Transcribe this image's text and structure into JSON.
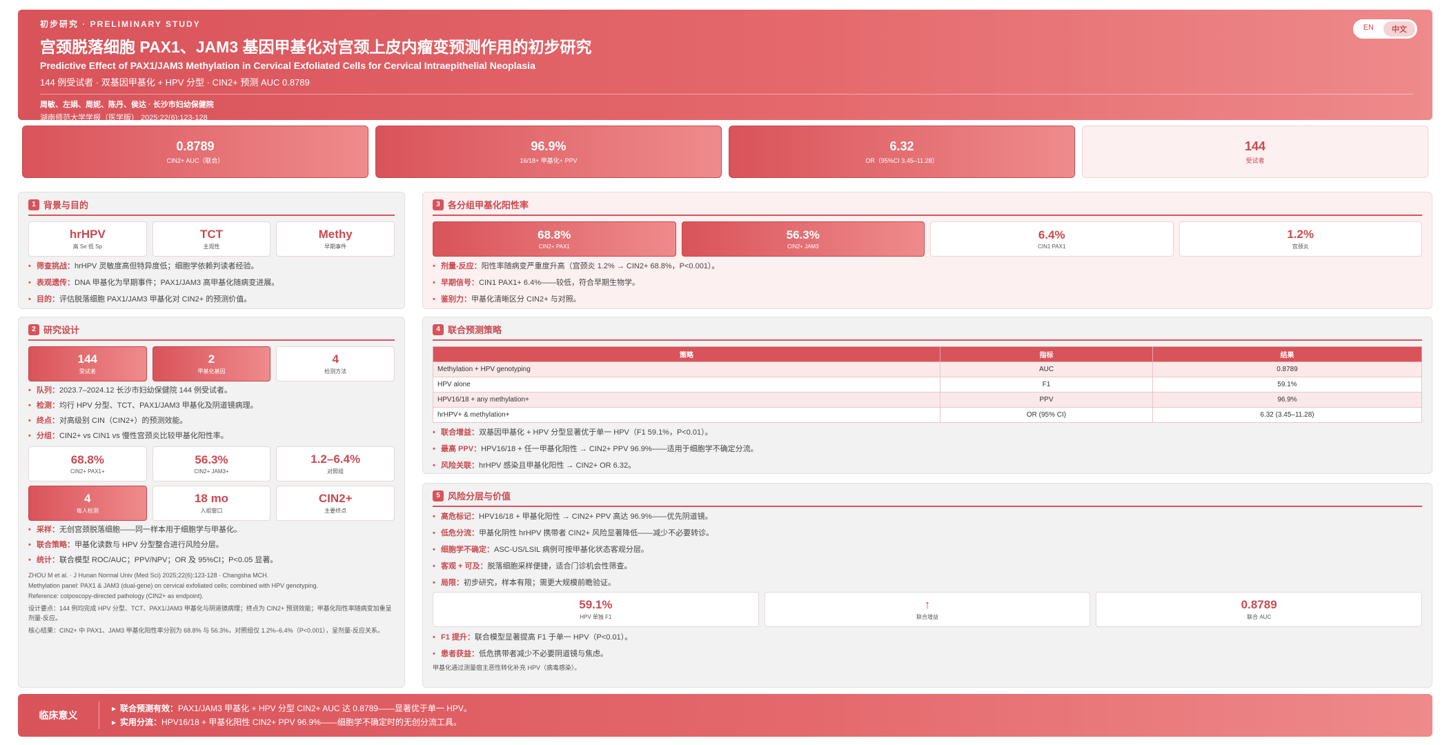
{
  "header": {
    "kicker": "初步研究 · PRELIMINARY STUDY",
    "title_zh": "宫颈脱落细胞 PAX1、JAM3 基因甲基化对宫颈上皮内瘤变预测作用的初步研究",
    "title_en": "Predictive Effect of PAX1/JAM3 Methylation in Cervical Exfoliated Cells for Cervical Intraepithelial Neoplasia",
    "summary": "144 例受试者 · 双基因甲基化 + HPV 分型 · CIN2+ 预测 AUC 0.8789",
    "authors": "周敏、左娟、周妮、陈丹、侯达 · 长沙市妇幼保健院",
    "journal": "湖南师范大学学报（医学版） 2025;22(6):123-128",
    "lang": [
      "EN",
      "中文"
    ]
  },
  "kpis": [
    {
      "value": "0.8789",
      "label": "CIN2+ AUC（联合）"
    },
    {
      "value": "96.9%",
      "label": "16/18+ 甲基化+ PPV"
    },
    {
      "value": "6.32",
      "label": "OR（95%CI 3.45–11.28）"
    },
    {
      "value": "144",
      "label": "受试者"
    }
  ],
  "s1": {
    "num": "1",
    "title": "背景与目的",
    "cards": [
      {
        "value": "hrHPV",
        "label": "高 Se 低 Sp"
      },
      {
        "value": "TCT",
        "label": "主观性"
      },
      {
        "value": "Methy",
        "label": "早期事件"
      }
    ],
    "bullets": [
      {
        "k": "筛查挑战：",
        "t": "hrHPV 灵敏度高但特异度低；细胞学依赖判读者经验。"
      },
      {
        "k": "表观遗传：",
        "t": "DNA 甲基化为早期事件；PAX1/JAM3 高甲基化随病变进展。"
      },
      {
        "k": "目的：",
        "t": "评估脱落细胞 PAX1/JAM3 甲基化对 CIN2+ 的预测价值。"
      }
    ]
  },
  "s2": {
    "num": "2",
    "title": "研究设计",
    "cards1": [
      {
        "value": "144",
        "label": "受试者"
      },
      {
        "value": "2",
        "label": "甲基化基因"
      },
      {
        "value": "4",
        "label": "检测方法"
      }
    ],
    "bullets1": [
      {
        "k": "队列：",
        "t": "2023.7–2024.12 长沙市妇幼保健院 144 例受试者。"
      },
      {
        "k": "检测：",
        "t": "均行 HPV 分型、TCT、PAX1/JAM3 甲基化及阴道镜病理。"
      },
      {
        "k": "终点：",
        "t": "对高级别 CIN（CIN2+）的预测效能。"
      },
      {
        "k": "分组：",
        "t": "CIN2+ vs CIN1 vs 慢性宫颈炎比较甲基化阳性率。"
      }
    ],
    "cards2": [
      {
        "value": "68.8%",
        "label": "CIN2+ PAX1+"
      },
      {
        "value": "56.3%",
        "label": "CIN2+ JAM3+"
      },
      {
        "value": "1.2–6.4%",
        "label": "对照组"
      }
    ],
    "cards3": [
      {
        "value": "4",
        "label": "每人检测"
      },
      {
        "value": "18 mo",
        "label": "入组窗口"
      },
      {
        "value": "CIN2+",
        "label": "主要终点"
      }
    ],
    "bullets2": [
      {
        "k": "采样：",
        "t": "无创宫颈脱落细胞——同一样本用于细胞学与甲基化。"
      },
      {
        "k": "联合策略：",
        "t": "甲基化读数与 HPV 分型整合进行风险分层。"
      },
      {
        "k": "统计：",
        "t": "联合模型 ROC/AUC；PPV/NPV；OR 及 95%CI；P<0.05 显著。"
      }
    ],
    "ref1": "ZHOU M et al. · J Hunan Normal Univ (Med Sci) 2025;22(6):123-128 · Changsha MCH.",
    "ref2": "Methylation panel: PAX1 & JAM3 (dual-gene) on cervical exfoliated cells; combined with HPV genotyping.",
    "ref3": "Reference: colposcopy-directed pathology (CIN2+ as endpoint).",
    "note1": "设计要点：144 例均完成 HPV 分型、TCT、PAX1/JAM3 甲基化与阴道镜病理；终点为 CIN2+ 预测效能；甲基化阳性率随病变加重呈剂量-反应。",
    "note2": "核心结果：CIN2+ 中 PAX1、JAM3 甲基化阳性率分别为 68.8% 与 56.3%，对照组仅 1.2%–6.4%（P<0.001），呈剂量-反应关系。"
  },
  "s3": {
    "num": "3",
    "title": "各分组甲基化阳性率",
    "cards": [
      {
        "value": "68.8%",
        "label": "CIN2+ PAX1"
      },
      {
        "value": "56.3%",
        "label": "CIN2+ JAM3"
      },
      {
        "value": "6.4%",
        "label": "CIN1 PAX1"
      },
      {
        "value": "1.2%",
        "label": "宫颈炎"
      }
    ],
    "bullets": [
      {
        "k": "剂量-反应：",
        "t": "阳性率随病变严重度升高（宫颈炎 1.2% → CIN2+ 68.8%，P<0.001）。"
      },
      {
        "k": "早期信号：",
        "t": "CIN1 PAX1+ 6.4%——较低，符合早期生物学。"
      },
      {
        "k": "鉴别力：",
        "t": "甲基化清晰区分 CIN2+ 与对照。"
      }
    ]
  },
  "s4": {
    "num": "4",
    "title": "联合预测策略",
    "columns": [
      "策略",
      "指标",
      "结果"
    ],
    "rows": [
      [
        "Methylation + HPV genotyping",
        "AUC",
        "0.8789"
      ],
      [
        "HPV alone",
        "F1",
        "59.1%"
      ],
      [
        "HPV16/18 + any methylation+",
        "PPV",
        "96.9%"
      ],
      [
        "hrHPV+ & methylation+",
        "OR (95% CI)",
        "6.32 (3.45–11.28)"
      ]
    ],
    "bullets": [
      {
        "k": "联合增益：",
        "t": "双基因甲基化 + HPV 分型显著优于单一 HPV（F1 59.1%，P<0.01）。"
      },
      {
        "k": "最高 PPV：",
        "t": "HPV16/18 + 任一甲基化阳性 → CIN2+ PPV 96.9%——适用于细胞学不确定分流。"
      },
      {
        "k": "风险关联：",
        "t": "hrHPV 感染且甲基化阳性 → CIN2+ OR 6.32。"
      }
    ]
  },
  "s5": {
    "num": "5",
    "title": "风险分层与价值",
    "bullets1": [
      {
        "k": "高危标记：",
        "t": "HPV16/18 + 甲基化阳性 → CIN2+ PPV 高达 96.9%——优先阴道镜。"
      },
      {
        "k": "低危分流：",
        "t": "甲基化阴性 hrHPV 携带者 CIN2+ 风险显著降低——减少不必要转诊。"
      },
      {
        "k": "细胞学不确定：",
        "t": "ASC-US/LSIL 病例可按甲基化状态客观分层。"
      },
      {
        "k": "客观 + 可及：",
        "t": "脱落细胞采样便捷，适合门诊机会性筛查。"
      },
      {
        "k": "局限：",
        "t": "初步研究，样本有限；需更大规模前瞻验证。"
      }
    ],
    "cards": [
      {
        "value": "59.1%",
        "label": "HPV 单独 F1"
      },
      {
        "value": "↑",
        "label": "联合增益"
      },
      {
        "value": "0.8789",
        "label": "联合 AUC"
      }
    ],
    "bullets2": [
      {
        "k": "F1 提升：",
        "t": "联合模型显著提高 F1 于单一 HPV（P<0.01）。"
      },
      {
        "k": "患者获益：",
        "t": "低危携带者减少不必要阴道镜与焦虑。"
      }
    ],
    "note": "甲基化通过测量宿主恶性转化补充 HPV（病毒感染）。"
  },
  "footer": {
    "title": "临床意义",
    "items": [
      {
        "k": "联合预测有效：",
        "t": "PAX1/JAM3 甲基化 + HPV 分型 CIN2+ AUC 达 0.8789——显著优于单一 HPV。"
      },
      {
        "k": "实用分流：",
        "t": "HPV16/18 + 甲基化阳性 CIN2+ PPV 96.9%——细胞学不确定时的无创分流工具。"
      }
    ]
  }
}
